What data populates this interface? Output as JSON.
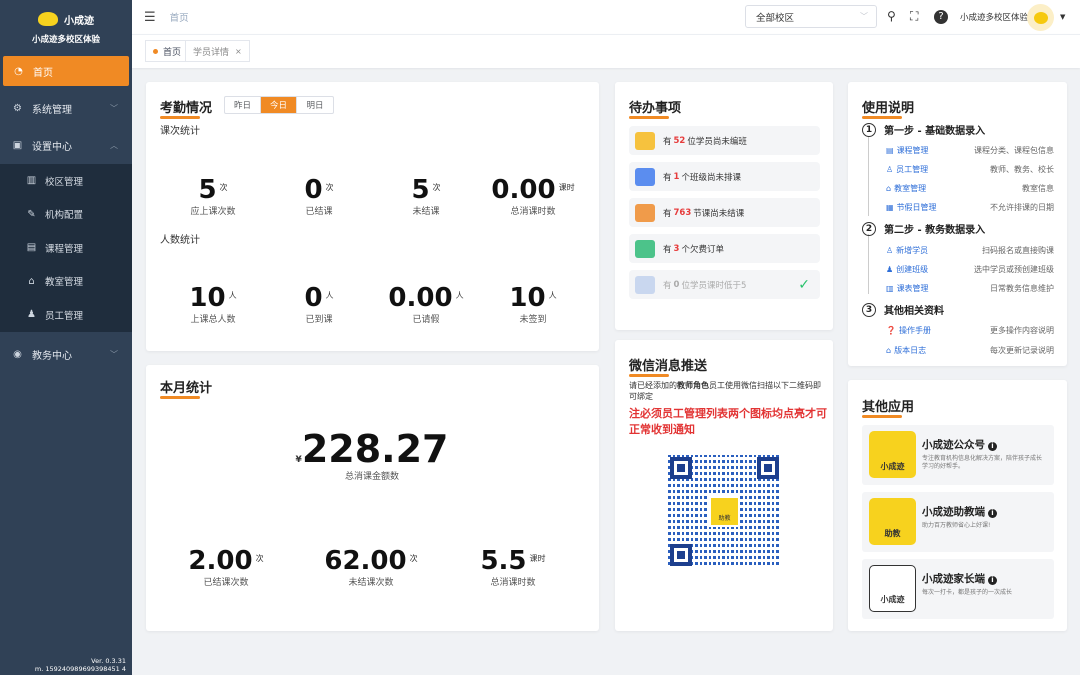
{
  "brand": {
    "name": "小成迹",
    "subtitle": "小成迹多校区体验"
  },
  "sidebar": {
    "home": "首页",
    "system": "系统管理",
    "settings": "设置中心",
    "settings_children": [
      "校区管理",
      "机构配置",
      "课程管理",
      "教室管理",
      "员工管理"
    ],
    "edu": "教务中心"
  },
  "version": {
    "line1": "Ver. 0.3.31",
    "line2": "m. 159240989699398451 4"
  },
  "topbar": {
    "breadcrumb": "首页",
    "campus_select": "全部校区",
    "user_name": "小成迹多校区体验"
  },
  "tags": [
    {
      "label": "首页",
      "active": true
    },
    {
      "label": "学员详情",
      "active": false
    }
  ],
  "attendance": {
    "title": "考勤情况",
    "tabs": [
      "昨日",
      "今日",
      "明日"
    ],
    "active_tab": "今日",
    "class_title": "课次统计",
    "class_stats": [
      {
        "value": "5",
        "unit": "次",
        "label": "应上课次数"
      },
      {
        "value": "0",
        "unit": "次",
        "label": "已结课"
      },
      {
        "value": "5",
        "unit": "次",
        "label": "未结课"
      },
      {
        "value": "0.00",
        "unit": "课时",
        "label": "总消课时数"
      }
    ],
    "people_title": "人数统计",
    "people_stats": [
      {
        "value": "10",
        "unit": "人",
        "label": "上课总人数"
      },
      {
        "value": "0",
        "unit": "人",
        "label": "已到课"
      },
      {
        "value": "0.00",
        "unit": "人",
        "label": "已请假"
      },
      {
        "value": "10",
        "unit": "人",
        "label": "未签到"
      }
    ]
  },
  "monthly": {
    "title": "本月统计",
    "currency": "¥",
    "total_amount": "228.27",
    "total_label": "总消课金额数",
    "stats": [
      {
        "value": "2.00",
        "unit": "次",
        "label": "已结课次数"
      },
      {
        "value": "62.00",
        "unit": "次",
        "label": "未结课次数"
      },
      {
        "value": "5.5",
        "unit": "课时",
        "label": "总消课时数"
      }
    ]
  },
  "todo": {
    "title": "待办事项",
    "items": [
      {
        "pre": "有",
        "num": "52",
        "post": "位学员尚未编班"
      },
      {
        "pre": "有",
        "num": "1",
        "post": "个班级尚未排课"
      },
      {
        "pre": "有",
        "num": "763",
        "post": "节课尚未结课"
      },
      {
        "pre": "有",
        "num": "3",
        "post": "个欠费订单"
      },
      {
        "pre": "有",
        "num": "0",
        "post": "位学员课时低于5"
      }
    ]
  },
  "wechat": {
    "title": "微信消息推送",
    "desc_pre": "请已经添加的",
    "desc_bold": "教师角色",
    "desc_post": "员工使用微信扫描以下二维码即可绑定",
    "warning": "注必须员工管理列表两个图标均点亮才可正常收到通知",
    "qr_center": "助教"
  },
  "guide": {
    "title": "使用说明",
    "steps": [
      {
        "num": "1",
        "title": "第一步 - 基础数据录入",
        "rows": [
          {
            "link": "课程管理",
            "desc": "课程分类、课程包信息"
          },
          {
            "link": "员工管理",
            "desc": "教师、教务、校长"
          },
          {
            "link": "教室管理",
            "desc": "教室信息"
          },
          {
            "link": "节假日管理",
            "desc": "不允许排课的日期"
          }
        ]
      },
      {
        "num": "2",
        "title": "第二步 - 教务数据录入",
        "rows": [
          {
            "link": "新增学员",
            "desc": "扫码报名或直接购课"
          },
          {
            "link": "创建班级",
            "desc": "选中学员或预创建班级"
          },
          {
            "link": "课表管理",
            "desc": "日常教务信息维护"
          }
        ]
      },
      {
        "num": "3",
        "title": "其他相关资料",
        "rows": [
          {
            "link": "操作手册",
            "desc": "更多操作内容说明"
          },
          {
            "link": "版本日志",
            "desc": "每次更新记录说明"
          }
        ]
      }
    ]
  },
  "apps": {
    "title": "其他应用",
    "items": [
      {
        "name": "小成迹公众号",
        "logo": "小成迹",
        "desc": "专注教育机构信息化解决方案，陪伴孩子成长学习的好帮手。"
      },
      {
        "name": "小成迹助教端",
        "logo": "助教",
        "desc": "助力百万教师省心上好课!"
      },
      {
        "name": "小成迹家长端",
        "logo": "小成迹",
        "desc": "每次一打卡，都是孩子的一次成长"
      }
    ]
  },
  "colors": {
    "accent": "#f08a24",
    "sidebar": "#304156",
    "warn": "#e23434",
    "link": "#2f6fd8"
  }
}
